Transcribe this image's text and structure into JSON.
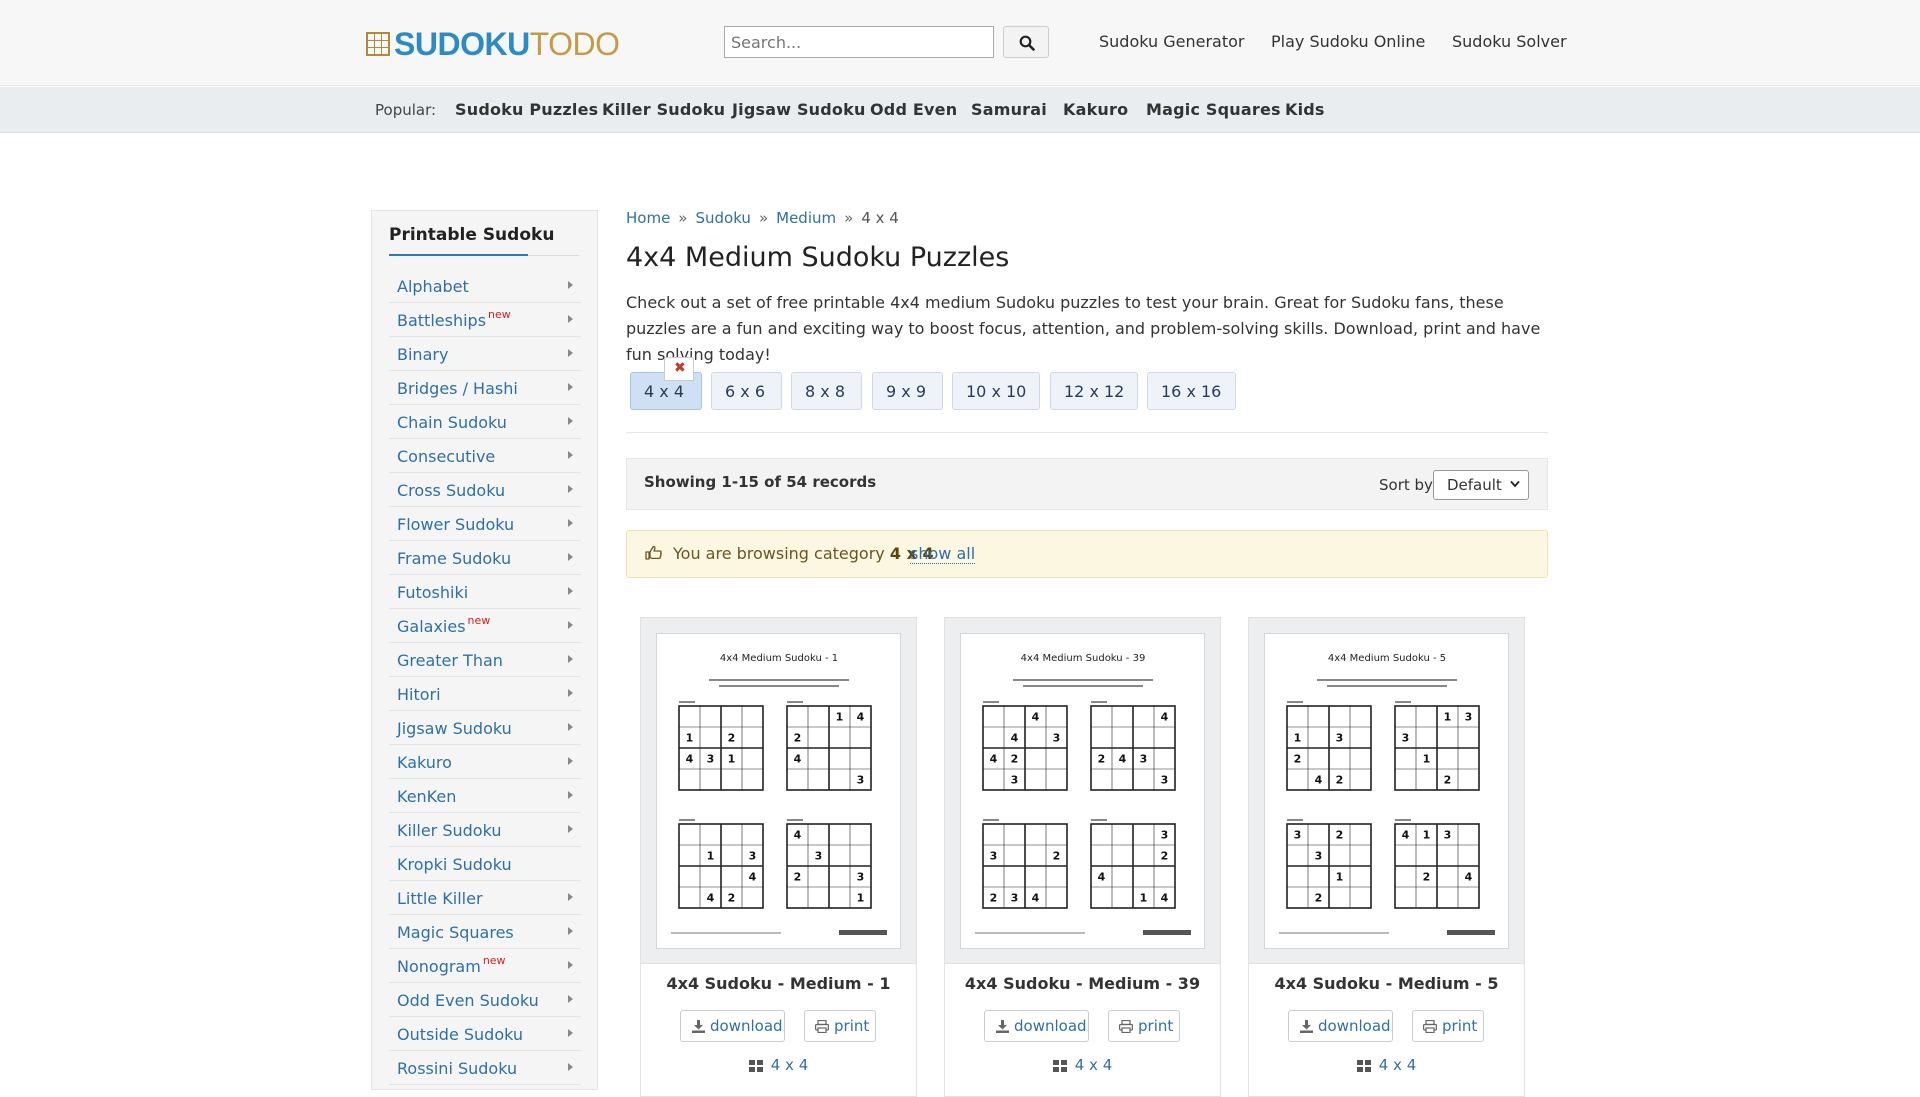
{
  "header": {
    "logo_bold": "SUDOKU",
    "logo_light": "TODO",
    "search_placeholder": "Search...",
    "nav": [
      "Sudoku Generator",
      "Play Sudoku Online",
      "Sudoku Solver"
    ]
  },
  "popular": {
    "label": "Popular:",
    "links": [
      "Sudoku Puzzles",
      "Killer Sudoku",
      "Jigsaw Sudoku",
      "Odd Even",
      "Samurai",
      "Kakuro",
      "Magic Squares",
      "Kids"
    ]
  },
  "sidebar": {
    "title": "Printable Sudoku",
    "new_label": "new",
    "items": [
      {
        "label": "Alphabet",
        "new": false,
        "caret": true
      },
      {
        "label": "Battleships",
        "new": true,
        "caret": true
      },
      {
        "label": "Binary",
        "new": false,
        "caret": true
      },
      {
        "label": "Bridges / Hashi",
        "new": false,
        "caret": true
      },
      {
        "label": "Chain Sudoku",
        "new": false,
        "caret": true
      },
      {
        "label": "Consecutive",
        "new": false,
        "caret": true
      },
      {
        "label": "Cross Sudoku",
        "new": false,
        "caret": true
      },
      {
        "label": "Flower Sudoku",
        "new": false,
        "caret": true
      },
      {
        "label": "Frame Sudoku",
        "new": false,
        "caret": true
      },
      {
        "label": "Futoshiki",
        "new": false,
        "caret": true
      },
      {
        "label": "Galaxies",
        "new": true,
        "caret": true
      },
      {
        "label": "Greater Than",
        "new": false,
        "caret": true
      },
      {
        "label": "Hitori",
        "new": false,
        "caret": true
      },
      {
        "label": "Jigsaw Sudoku",
        "new": false,
        "caret": true
      },
      {
        "label": "Kakuro",
        "new": false,
        "caret": true
      },
      {
        "label": "KenKen",
        "new": false,
        "caret": true
      },
      {
        "label": "Killer Sudoku",
        "new": false,
        "caret": true
      },
      {
        "label": "Kropki Sudoku",
        "new": false,
        "caret": false
      },
      {
        "label": "Little Killer",
        "new": false,
        "caret": true
      },
      {
        "label": "Magic Squares",
        "new": false,
        "caret": true
      },
      {
        "label": "Nonogram",
        "new": true,
        "caret": true
      },
      {
        "label": "Odd Even Sudoku",
        "new": false,
        "caret": true
      },
      {
        "label": "Outside Sudoku",
        "new": false,
        "caret": true
      },
      {
        "label": "Rossini Sudoku",
        "new": false,
        "caret": true
      }
    ]
  },
  "breadcrumb": {
    "items": [
      "Home",
      "Sudoku",
      "Medium"
    ],
    "current": "4 x 4",
    "separator": "»"
  },
  "main": {
    "title": "4x4 Medium Sudoku Puzzles",
    "intro": "Check out a set of free printable 4x4 medium Sudoku puzzles to test your brain. Great for Sudoku fans, these puzzles are a fun and exciting way to boost focus, attention, and problem-solving skills. Download, print and have fun solving today!",
    "sizes": [
      "4 x 4",
      "6 x 6",
      "8 x 8",
      "9 x 9",
      "10 x 10",
      "12 x 12",
      "16 x 16"
    ],
    "active_size": "4 x 4",
    "records": "Showing 1-15 of 54 records",
    "sort_label": "Sort by:",
    "sort_value": "Default",
    "alert_prefix": "You are browsing category",
    "alert_category": "4 x 4",
    "show_all": "show all"
  },
  "cards": [
    {
      "sheet_title": "4x4 Medium Sudoku - 1",
      "title": "4x4 Sudoku - Medium - 1",
      "download": "download",
      "print": "print",
      "category": "4 x 4",
      "puzzles": [
        [
          [
            "",
            "",
            "",
            ""
          ],
          [
            "1",
            "",
            "2",
            ""
          ],
          [
            "4",
            "3",
            "1",
            ""
          ],
          [
            "",
            "",
            "",
            ""
          ]
        ],
        [
          [
            "",
            "",
            "1",
            "4"
          ],
          [
            "2",
            "",
            "",
            ""
          ],
          [
            "4",
            "",
            "",
            ""
          ],
          [
            "",
            "",
            "",
            "3"
          ]
        ],
        [
          [
            "",
            "",
            "",
            ""
          ],
          [
            "",
            "1",
            "",
            "3"
          ],
          [
            "",
            "",
            "",
            "4"
          ],
          [
            "",
            "4",
            "2",
            ""
          ]
        ],
        [
          [
            "4",
            "",
            "",
            ""
          ],
          [
            "",
            "3",
            "",
            ""
          ],
          [
            "2",
            "",
            "",
            "3"
          ],
          [
            "",
            "",
            "",
            "1"
          ]
        ]
      ]
    },
    {
      "sheet_title": "4x4 Medium Sudoku - 39",
      "title": "4x4 Sudoku - Medium - 39",
      "download": "download",
      "print": "print",
      "category": "4 x 4",
      "puzzles": [
        [
          [
            "",
            "",
            "4",
            ""
          ],
          [
            "",
            "4",
            "",
            "3"
          ],
          [
            "4",
            "2",
            "",
            ""
          ],
          [
            "",
            "3",
            "",
            ""
          ]
        ],
        [
          [
            "",
            "",
            "",
            "4"
          ],
          [
            "",
            "",
            "",
            ""
          ],
          [
            "2",
            "4",
            "3",
            ""
          ],
          [
            "",
            "",
            "",
            "3"
          ]
        ],
        [
          [
            "",
            "",
            "",
            ""
          ],
          [
            "3",
            "",
            "",
            "2"
          ],
          [
            "",
            "",
            "",
            ""
          ],
          [
            "2",
            "3",
            "4",
            ""
          ]
        ],
        [
          [
            "",
            "",
            "",
            "3"
          ],
          [
            "",
            "",
            "",
            "2"
          ],
          [
            "4",
            "",
            "",
            ""
          ],
          [
            "",
            "",
            "1",
            "4"
          ]
        ]
      ]
    },
    {
      "sheet_title": "4x4 Medium Sudoku - 5",
      "title": "4x4 Sudoku - Medium - 5",
      "download": "download",
      "print": "print",
      "category": "4 x 4",
      "puzzles": [
        [
          [
            "",
            "",
            "",
            ""
          ],
          [
            "1",
            "",
            "3",
            ""
          ],
          [
            "2",
            "",
            "",
            ""
          ],
          [
            "",
            "4",
            "2",
            ""
          ]
        ],
        [
          [
            "",
            "",
            "1",
            "3"
          ],
          [
            "3",
            "",
            "",
            ""
          ],
          [
            "",
            "1",
            "",
            ""
          ],
          [
            "",
            "",
            "2",
            ""
          ]
        ],
        [
          [
            "3",
            "",
            "2",
            ""
          ],
          [
            "",
            "3",
            "",
            ""
          ],
          [
            "",
            "",
            "1",
            ""
          ],
          [
            "",
            "2",
            "",
            ""
          ]
        ],
        [
          [
            "4",
            "1",
            "3",
            ""
          ],
          [
            "",
            "",
            "",
            ""
          ],
          [
            "",
            "2",
            "",
            "4"
          ],
          [
            "",
            "",
            "",
            ""
          ]
        ]
      ]
    }
  ],
  "colors": {
    "link": "#2f6fa8",
    "logo_blue": "#2d8bc4",
    "logo_gold": "#c39a46",
    "new_badge": "#d21f1f",
    "alert_bg": "#fcf7e0"
  }
}
